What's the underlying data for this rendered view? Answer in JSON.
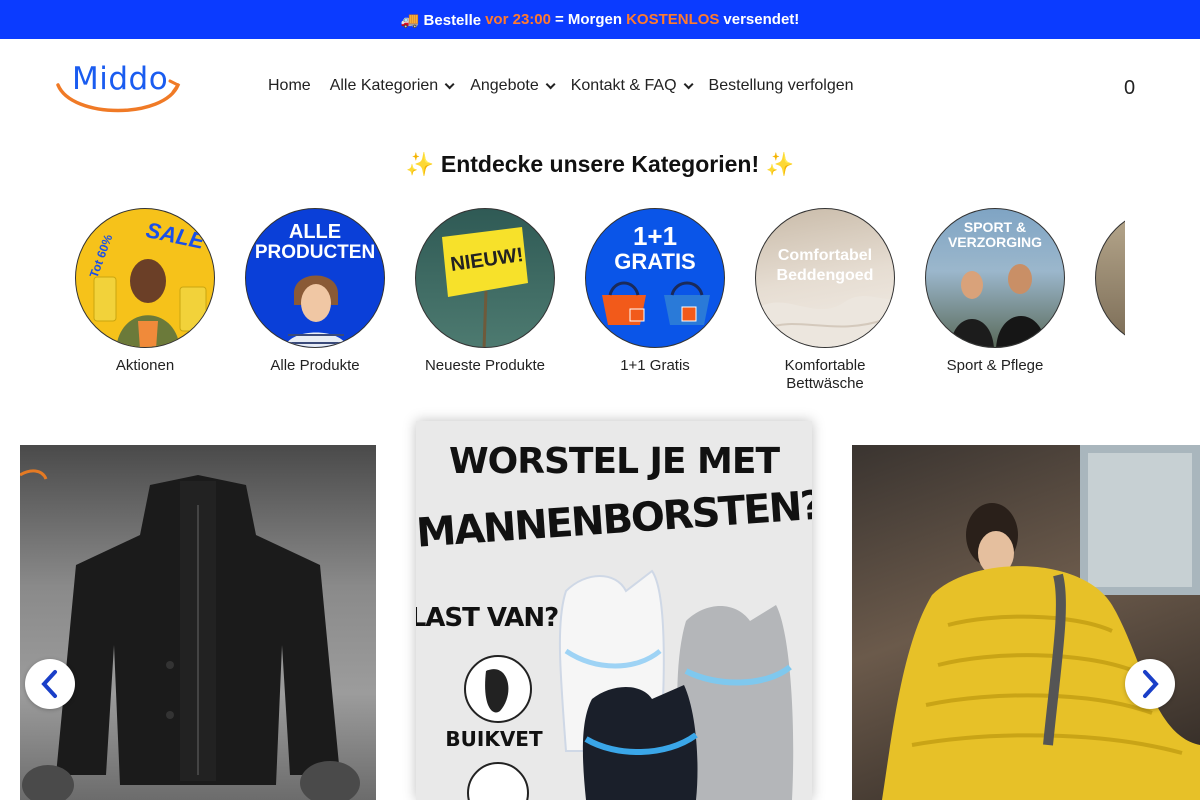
{
  "announcement": {
    "icon": "truck-icon",
    "part1": "🚚 Bestelle",
    "part2": "vor 23:00",
    "part3": "= Morgen",
    "part4": "KOSTENLOS",
    "part5": "versendet!",
    "bg_color": "#0b3bff",
    "highlight_color": "#ff7a2e"
  },
  "header": {
    "logo_text": "Middo",
    "nav": [
      {
        "label": "Home",
        "has_dropdown": false
      },
      {
        "label": "Alle Kategorien",
        "has_dropdown": true
      },
      {
        "label": "Angebote",
        "has_dropdown": true
      },
      {
        "label": "Kontakt & FAQ",
        "has_dropdown": true
      },
      {
        "label": "Bestellung verfolgen",
        "has_dropdown": false
      }
    ],
    "cart_count": "0"
  },
  "categories": {
    "title": "Entdecke unsere Kategorien!",
    "sparkle": "✨",
    "items": [
      {
        "label": "Aktionen",
        "image_text": [
          "SALE",
          "Tot 60%"
        ]
      },
      {
        "label": "Alle Produkte",
        "image_text": [
          "ALLE",
          "PRODUCTEN"
        ]
      },
      {
        "label": "Neueste Produkte",
        "image_text": [
          "NIEUW!"
        ]
      },
      {
        "label": "1+1 Gratis",
        "image_text": [
          "1+1",
          "GRATIS"
        ]
      },
      {
        "label": "Komfortable Bettwäsche",
        "image_text": [
          "Comfortabel",
          "Beddengoed"
        ]
      },
      {
        "label": "Sport & Pflege",
        "image_text": [
          "SPORT &",
          "VERZORGING"
        ]
      }
    ]
  },
  "banners": {
    "middle": {
      "line1": "WORSTEL JE MET",
      "line2": "MANNENBORSTEN?",
      "line3": "LAST VAN?",
      "line4": "BUIKVET"
    }
  }
}
